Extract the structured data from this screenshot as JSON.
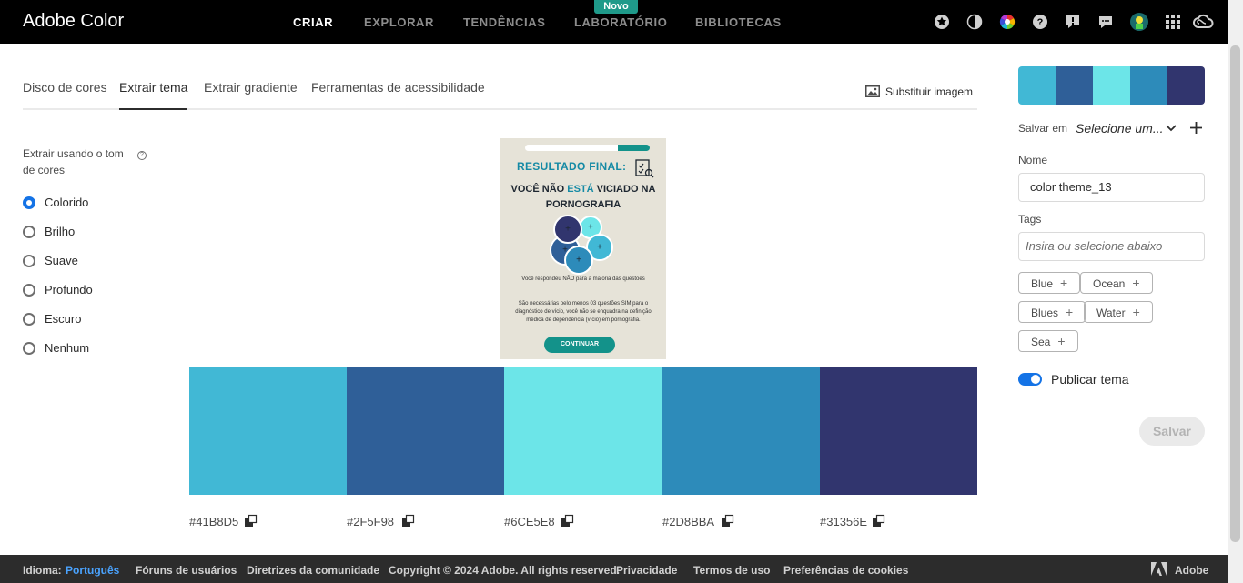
{
  "app": {
    "title": "Adobe Color"
  },
  "nav": {
    "items": [
      "CRIAR",
      "EXPLORAR",
      "TENDÊNCIAS",
      "LABORATÓRIO",
      "BIBLIOTECAS"
    ],
    "active": "CRIAR",
    "new_badge": "Novo"
  },
  "header_icons": [
    "star-icon",
    "contrast-icon",
    "color-wheel-icon",
    "help-icon",
    "alert-icon",
    "chat-icon",
    "avatar",
    "apps-grid-icon",
    "creative-cloud-icon"
  ],
  "tabs": [
    "Disco de cores",
    "Extrair tema",
    "Extrair gradiente",
    "Ferramentas de acessibilidade"
  ],
  "active_tab": "Extrair tema",
  "replace_image": "Substituir imagem",
  "extract": {
    "label": "Extrair usando o tom de cores",
    "options": [
      "Colorido",
      "Brilho",
      "Suave",
      "Profundo",
      "Escuro",
      "Nenhum"
    ],
    "selected": "Colorido"
  },
  "image": {
    "title": "RESULTADO FINAL:",
    "headline_a": "VOCÊ NÃO ",
    "headline_b": "ESTÁ",
    "headline_c": " VICIADO NA PORNOGRAFIA",
    "line1": "Você respondeu NÃO para a maioria das questões",
    "line2": "São necessárias pelo menos 03 questões SIM para o diagnóstico de vício, você não se enquadra na definição médica de dependência (vício) em pornografia.",
    "button": "CONTINUAR",
    "picker_glyph": "+"
  },
  "swatches": [
    {
      "color": "#41B8D5",
      "hex": "#41B8D5"
    },
    {
      "color": "#2F5F98",
      "hex": "#2F5F98"
    },
    {
      "color": "#6CE5E8",
      "hex": "#6CE5E8"
    },
    {
      "color": "#2D8BBA",
      "hex": "#2D8BBA"
    },
    {
      "color": "#31356E",
      "hex": "#31356E"
    }
  ],
  "panel": {
    "save_in_label": "Salvar em",
    "save_in_value": "Selecione um...",
    "name_label": "Nome",
    "name_value": "color theme_13",
    "tags_label": "Tags",
    "tags_placeholder": "Insira ou selecione abaixo",
    "tags": [
      "Blue",
      "Ocean",
      "Blues",
      "Water",
      "Sea"
    ],
    "publish_label": "Publicar tema",
    "publish_on": true,
    "save_button": "Salvar"
  },
  "footer": {
    "language_label": "Idioma:",
    "language": "Português",
    "links": [
      "Fóruns de usuários",
      "Diretrizes da comunidade",
      "Copyright © 2024 Adobe. All rights reserved.",
      "Privacidade",
      "Termos de uso",
      "Preferências de cookies"
    ],
    "brand": "Adobe"
  }
}
